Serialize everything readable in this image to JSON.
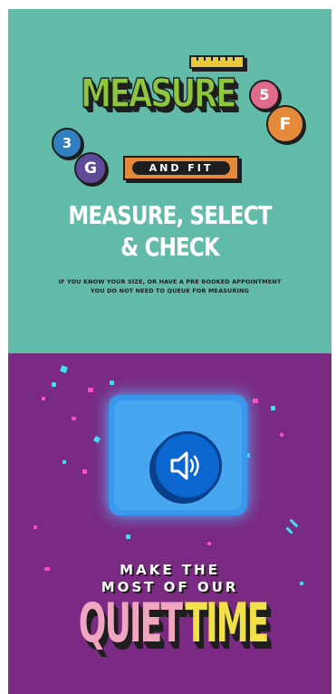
{
  "top_banner": {
    "logo": {
      "word": "MEASURE",
      "tag": "AND FIT",
      "balls": [
        "3",
        "G",
        "5",
        "F"
      ]
    },
    "headline": [
      "MEASURE, SELECT",
      "& CHECK"
    ],
    "note": [
      "IF YOU KNOW YOUR SIZE, OR HAVE A PRE BOOKED APPOINTMENT",
      "YOU DO NOT NEED TO QUEUE FOR MEASURING"
    ]
  },
  "bottom_banner": {
    "icon": "speaker-sound-icon",
    "line1": "MAKE THE",
    "line2": "MOST OF OUR",
    "quiet": "QUIET",
    "time": "TIME"
  },
  "colors": {
    "teal_bg": "#62bba9",
    "purple_bg": "#7a2a82",
    "logo_green": "#8ec63f",
    "orange": "#e5893a",
    "pink": "#f0a6c0",
    "yellow": "#f2e04a",
    "cube_blue": "#3a98ec"
  }
}
